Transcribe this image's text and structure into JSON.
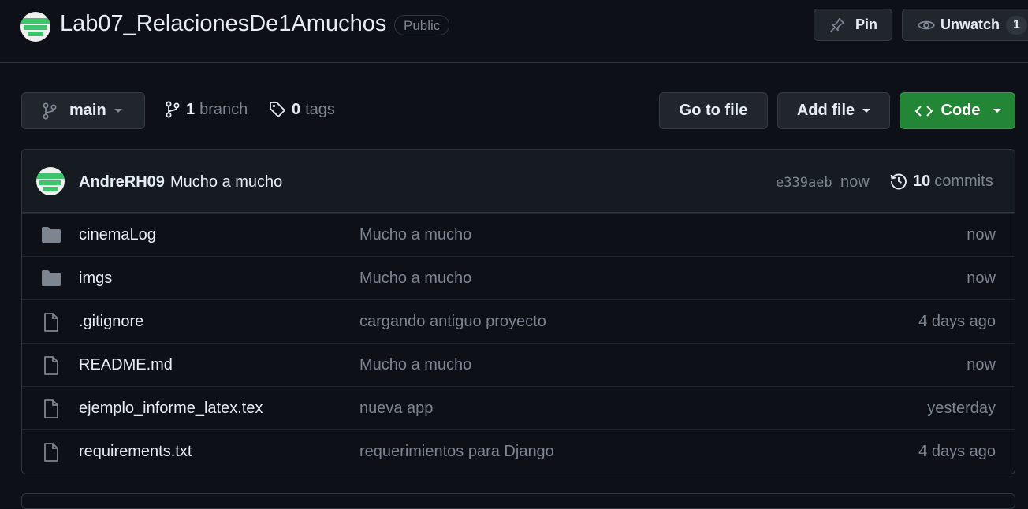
{
  "repo": {
    "name": "Lab07_RelacionesDe1Amuchos",
    "visibility": "Public"
  },
  "header_actions": {
    "pin_label": "Pin",
    "unwatch_label": "Unwatch",
    "watch_count": "1"
  },
  "toolbar": {
    "branch_name": "main",
    "branch_count": "1",
    "branch_label": "branch",
    "tag_count": "0",
    "tag_label": "tags",
    "go_to_file": "Go to file",
    "add_file": "Add file",
    "code": "Code"
  },
  "latest_commit": {
    "author": "AndreRH09",
    "message": "Mucho a mucho",
    "sha": "e339aeb",
    "time": "now",
    "commit_count": "10",
    "commit_label": "commits"
  },
  "files": [
    {
      "type": "folder-icon",
      "name": "cinemaLog",
      "message": "Mucho a mucho",
      "time": "now"
    },
    {
      "type": "folder-icon",
      "name": "imgs",
      "message": "Mucho a mucho",
      "time": "now"
    },
    {
      "type": "file-icon",
      "name": ".gitignore",
      "message": "cargando antiguo proyecto",
      "time": "4 days ago"
    },
    {
      "type": "file-icon",
      "name": "README.md",
      "message": "Mucho a mucho",
      "time": "now"
    },
    {
      "type": "file-icon",
      "name": "ejemplo_informe_latex.tex",
      "message": "nueva app",
      "time": "yesterday"
    },
    {
      "type": "file-icon",
      "name": "requirements.txt",
      "message": "requerimientos para Django",
      "time": "4 days ago"
    }
  ],
  "colors": {
    "background": "#0d1117",
    "code_button": "#238636",
    "avatar_accent": "#3ec46d"
  }
}
